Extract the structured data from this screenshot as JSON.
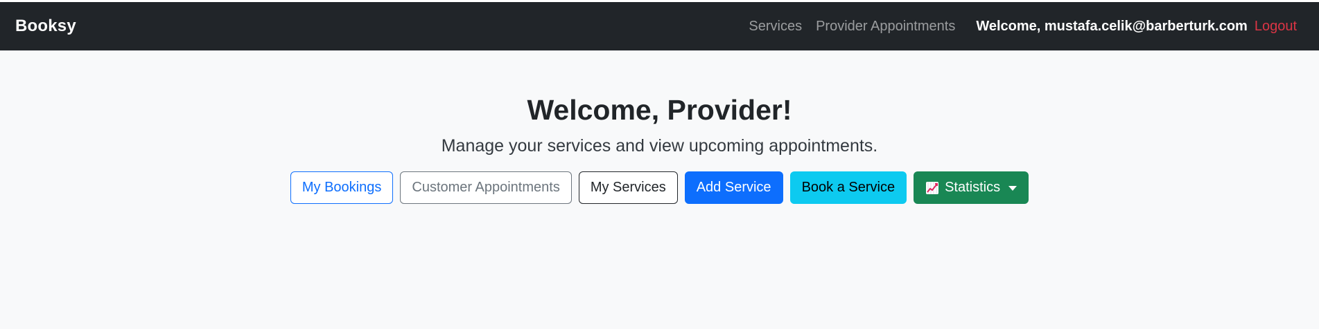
{
  "navbar": {
    "brand": "Booksy",
    "links": [
      {
        "label": "Services"
      },
      {
        "label": "Provider Appointments"
      }
    ],
    "welcome_text": "Welcome, mustafa.celik@barberturk.com",
    "logout_label": "Logout"
  },
  "hero": {
    "title": "Welcome, Provider!",
    "subtitle": "Manage your services and view upcoming appointments."
  },
  "actions": {
    "my_bookings": "My Bookings",
    "customer_appointments": "Customer Appointments",
    "my_services": "My Services",
    "add_service": "Add Service",
    "book_service": "Book a Service",
    "statistics": "Statistics",
    "statistics_icon": "chart-increasing-icon"
  },
  "colors": {
    "navbar_bg": "#212529",
    "page_bg": "#f8f9fa",
    "primary": "#0d6efd",
    "info": "#0dcaf0",
    "success": "#198754",
    "danger": "#dc3545"
  }
}
